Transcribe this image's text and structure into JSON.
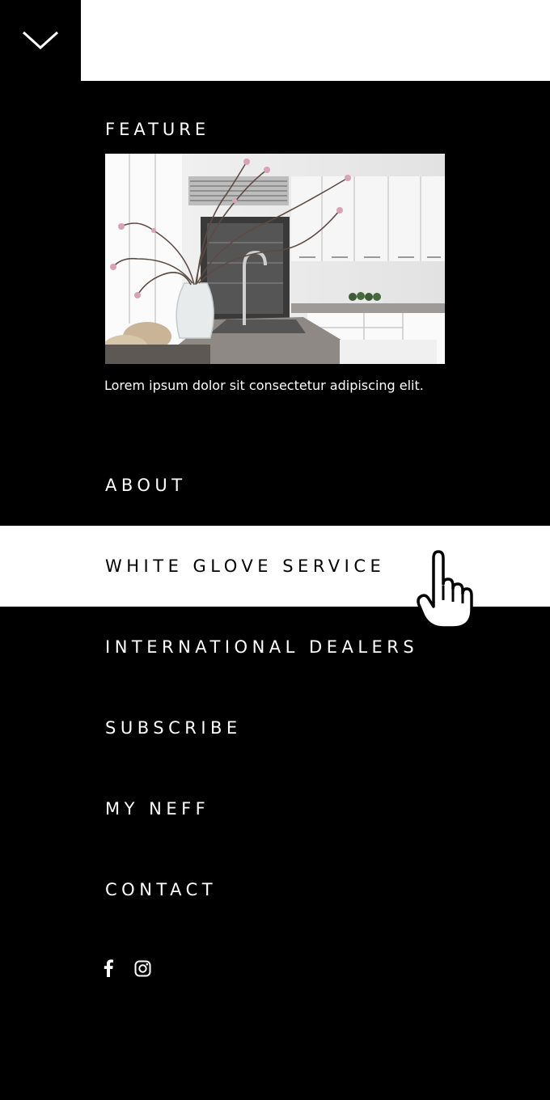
{
  "menu": {
    "toggle_icon": "chevron-down-icon"
  },
  "feature": {
    "heading": "FEATURE",
    "image": "kitchen-photo",
    "caption": "Lorem ipsum dolor sit consectetur adipiscing elit."
  },
  "nav": {
    "items": [
      {
        "label": "ABOUT",
        "active": false
      },
      {
        "label": "WHITE GLOVE SERVICE",
        "active": true
      },
      {
        "label": "INTERNATIONAL DEALERS",
        "active": false
      },
      {
        "label": "SUBSCRIBE",
        "active": false
      },
      {
        "label": "MY NEFF",
        "active": false
      },
      {
        "label": "CONTACT",
        "active": false
      }
    ]
  },
  "social": {
    "icons": [
      "facebook-icon",
      "instagram-icon"
    ]
  },
  "colors": {
    "background": "#000000",
    "active_item": "#ffffff"
  }
}
